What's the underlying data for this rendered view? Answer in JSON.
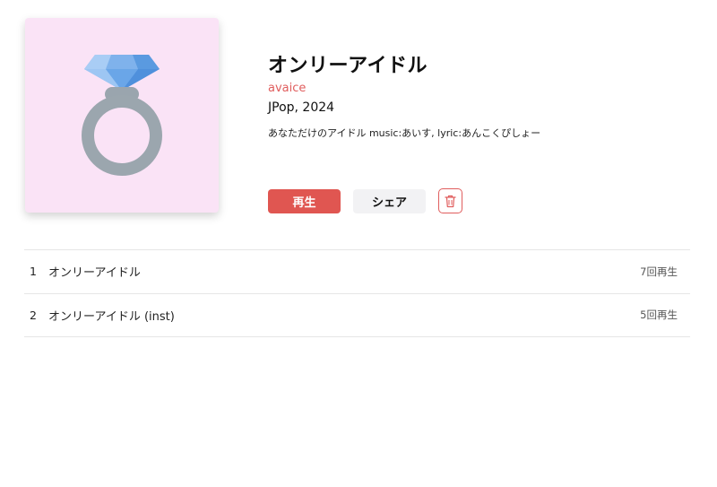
{
  "album": {
    "title": "オンリーアイドル",
    "artist": "avaice",
    "meta": "JPop, 2024",
    "description": "あなただけのアイドル music:あいす, lyric:あんこくぴしょー",
    "cover": {
      "icon": "diamond-ring-icon",
      "background": "#fae3f6"
    }
  },
  "actions": {
    "play_label": "再生",
    "share_label": "シェア",
    "delete_icon": "trash-icon"
  },
  "tracks": [
    {
      "number": "1",
      "title": "オンリーアイドル",
      "plays": "7回再生"
    },
    {
      "number": "2",
      "title": "オンリーアイドル (inst)",
      "plays": "5回再生"
    }
  ],
  "colors": {
    "accent": "#e05651",
    "artist": "#e05d5d",
    "share_bg": "#f2f2f4",
    "divider": "#e6e6e6"
  }
}
